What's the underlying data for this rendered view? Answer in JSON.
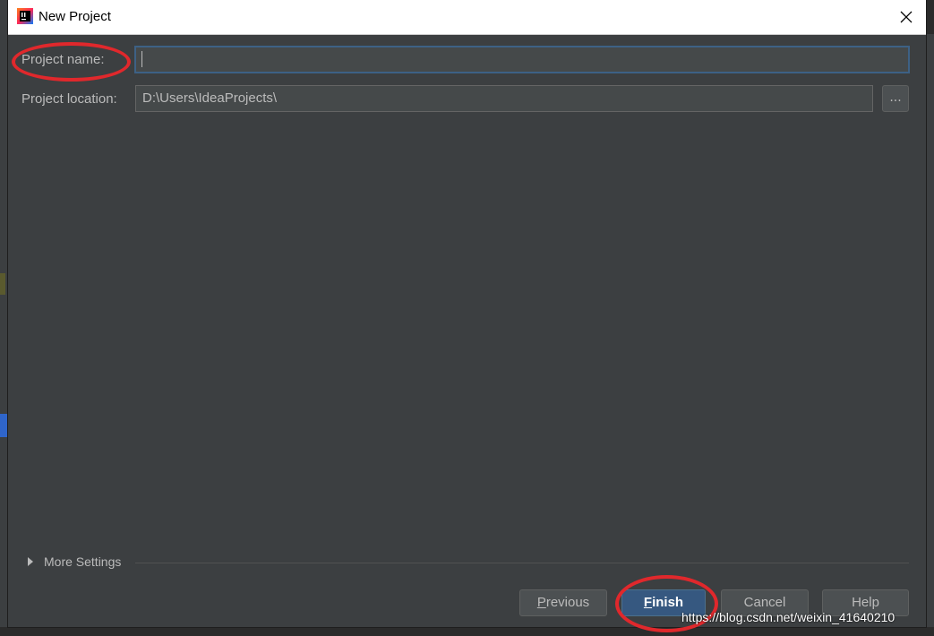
{
  "dialog": {
    "title": "New Project"
  },
  "form": {
    "project_name_label": "Project name:",
    "project_name_value": "",
    "project_location_label": "Project location:",
    "project_location_value": "D:\\Users\\IdeaProjects\\",
    "browse_label": "..."
  },
  "more_settings": {
    "label": "More Settings"
  },
  "buttons": {
    "previous": {
      "mnemonic": "P",
      "rest": "revious"
    },
    "finish": {
      "mnemonic": "F",
      "rest": "inish"
    },
    "cancel": "Cancel",
    "help": "Help"
  },
  "watermark": "https://blog.csdn.net/weixin_41640210",
  "colors": {
    "dialog_bg": "#3c3f41",
    "primary_button": "#365880",
    "annotation": "#e0282c"
  }
}
